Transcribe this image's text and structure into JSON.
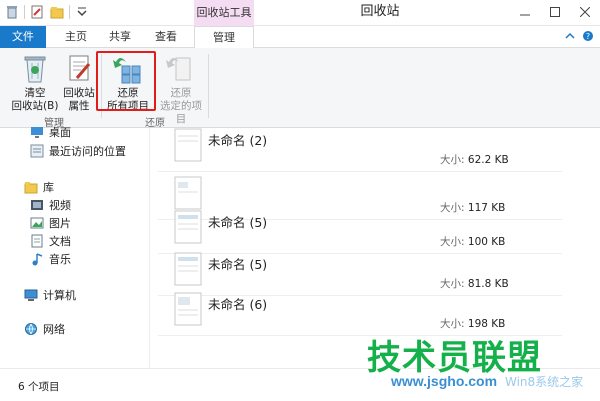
{
  "titlebar": {
    "context_tab_label": "回收站工具",
    "window_title": "回收站"
  },
  "tabs": [
    {
      "label": "文件"
    },
    {
      "label": "主页"
    },
    {
      "label": "共享"
    },
    {
      "label": "查看"
    },
    {
      "label": "管理"
    }
  ],
  "ribbon": {
    "empty_bin": {
      "line1": "清空",
      "line2": "回收站(B)"
    },
    "bin_properties": {
      "line1": "回收站",
      "line2": "属性"
    },
    "restore_all": {
      "line1": "还原",
      "line2": "所有项目"
    },
    "restore_selected": {
      "line1": "还原",
      "line2": "选定的项目"
    },
    "group_manage": "管理",
    "group_restore": "还原"
  },
  "nav": {
    "desktop": "桌面",
    "recent": "最近访问的位置",
    "libraries": "库",
    "videos": "视频",
    "pictures": "图片",
    "documents": "文档",
    "music": "音乐",
    "computer": "计算机",
    "network": "网络"
  },
  "files": [
    {
      "name": "未命名 (2)",
      "size_label": "大小:",
      "size": "62.2 KB"
    },
    {
      "name": "",
      "size_label": "大小:",
      "size": "117 KB"
    },
    {
      "name": "未命名 (5)",
      "size_label": "大小:",
      "size": "100 KB"
    },
    {
      "name": "未命名 (5)",
      "size_label": "大小:",
      "size": "81.8 KB"
    },
    {
      "name": "未命名 (6)",
      "size_label": "大小:",
      "size": "198 KB"
    }
  ],
  "status": {
    "item_count": "6 个项目"
  },
  "watermark": {
    "brand": "技术员联盟",
    "url": "www.jsgho.com",
    "sub": "Win8系统之家"
  },
  "colors": {
    "file_tab": "#1979ca",
    "context_tab": "#f4dcf2",
    "highlight": "#e21b1b",
    "watermark_green": "#14b04a"
  }
}
